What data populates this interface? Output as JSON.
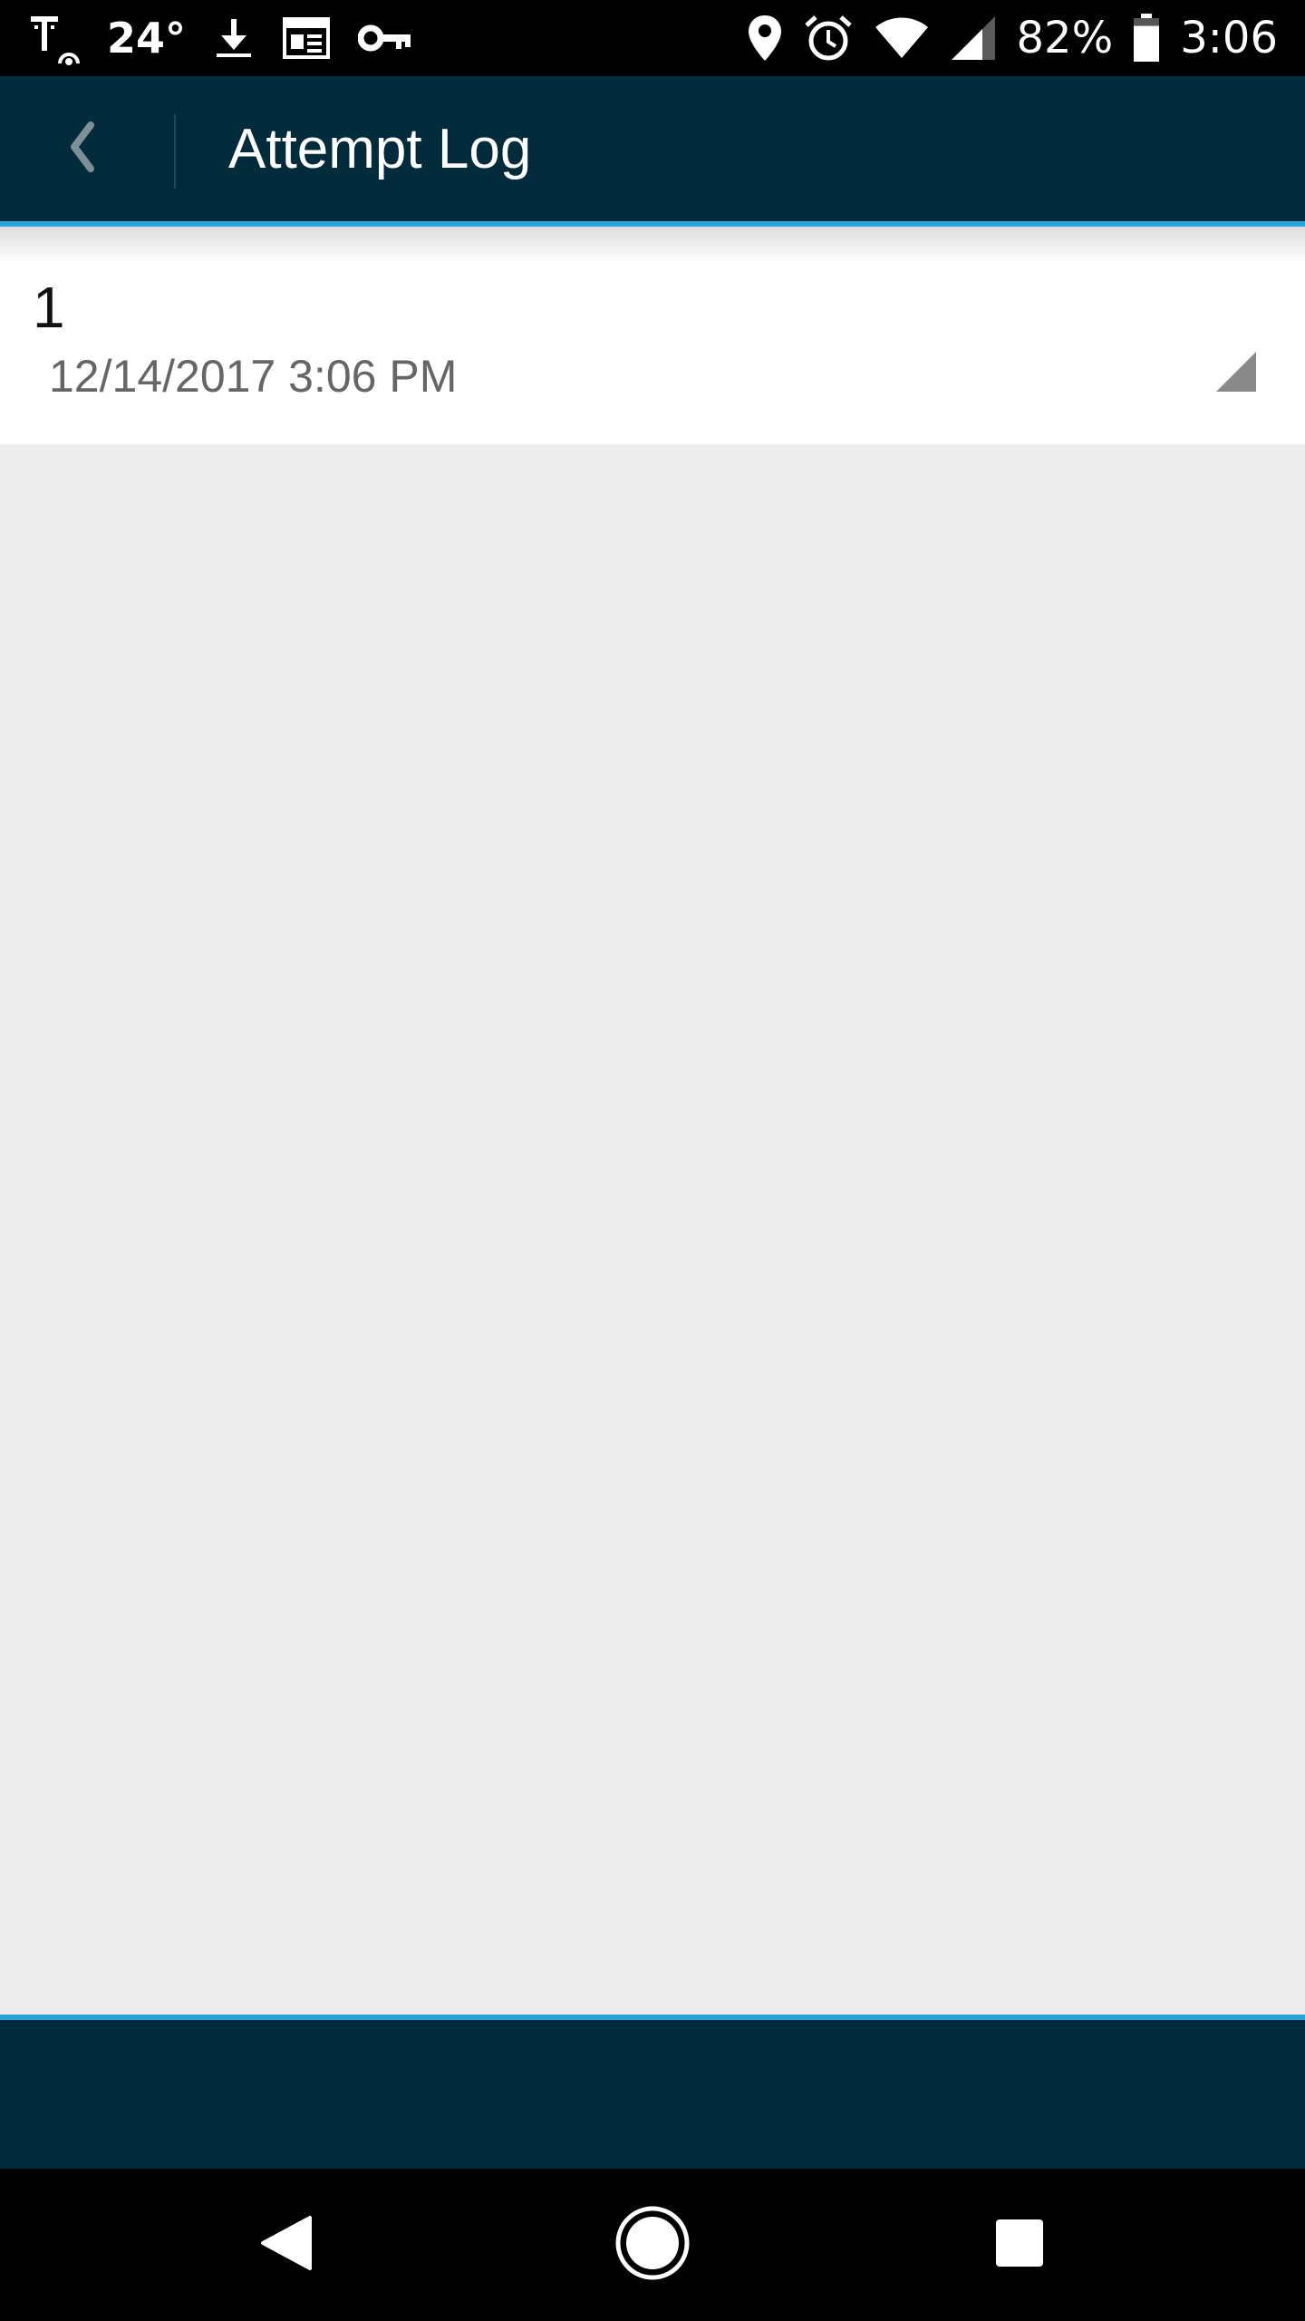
{
  "status_bar": {
    "temperature": "24°",
    "battery_percent": "82%",
    "battery_level": 0.82,
    "clock": "3:06",
    "left_icons": [
      "carrier-t-icon",
      "download-icon",
      "calendar-news-icon",
      "key-icon"
    ],
    "right_icons": [
      "location-icon",
      "alarm-icon",
      "wifi-icon",
      "cell-signal-icon",
      "battery-icon"
    ]
  },
  "app_bar": {
    "title": "Attempt Log",
    "back_icon": "chevron-left-icon",
    "background": "#022b3b",
    "accent": "#2aa3d8"
  },
  "list": {
    "items": [
      {
        "number": "1",
        "date": "12/14/2017 3:06 PM"
      }
    ]
  },
  "nav_bar": {
    "icons": [
      "back-triangle-icon",
      "home-circle-icon",
      "recents-square-icon"
    ]
  }
}
